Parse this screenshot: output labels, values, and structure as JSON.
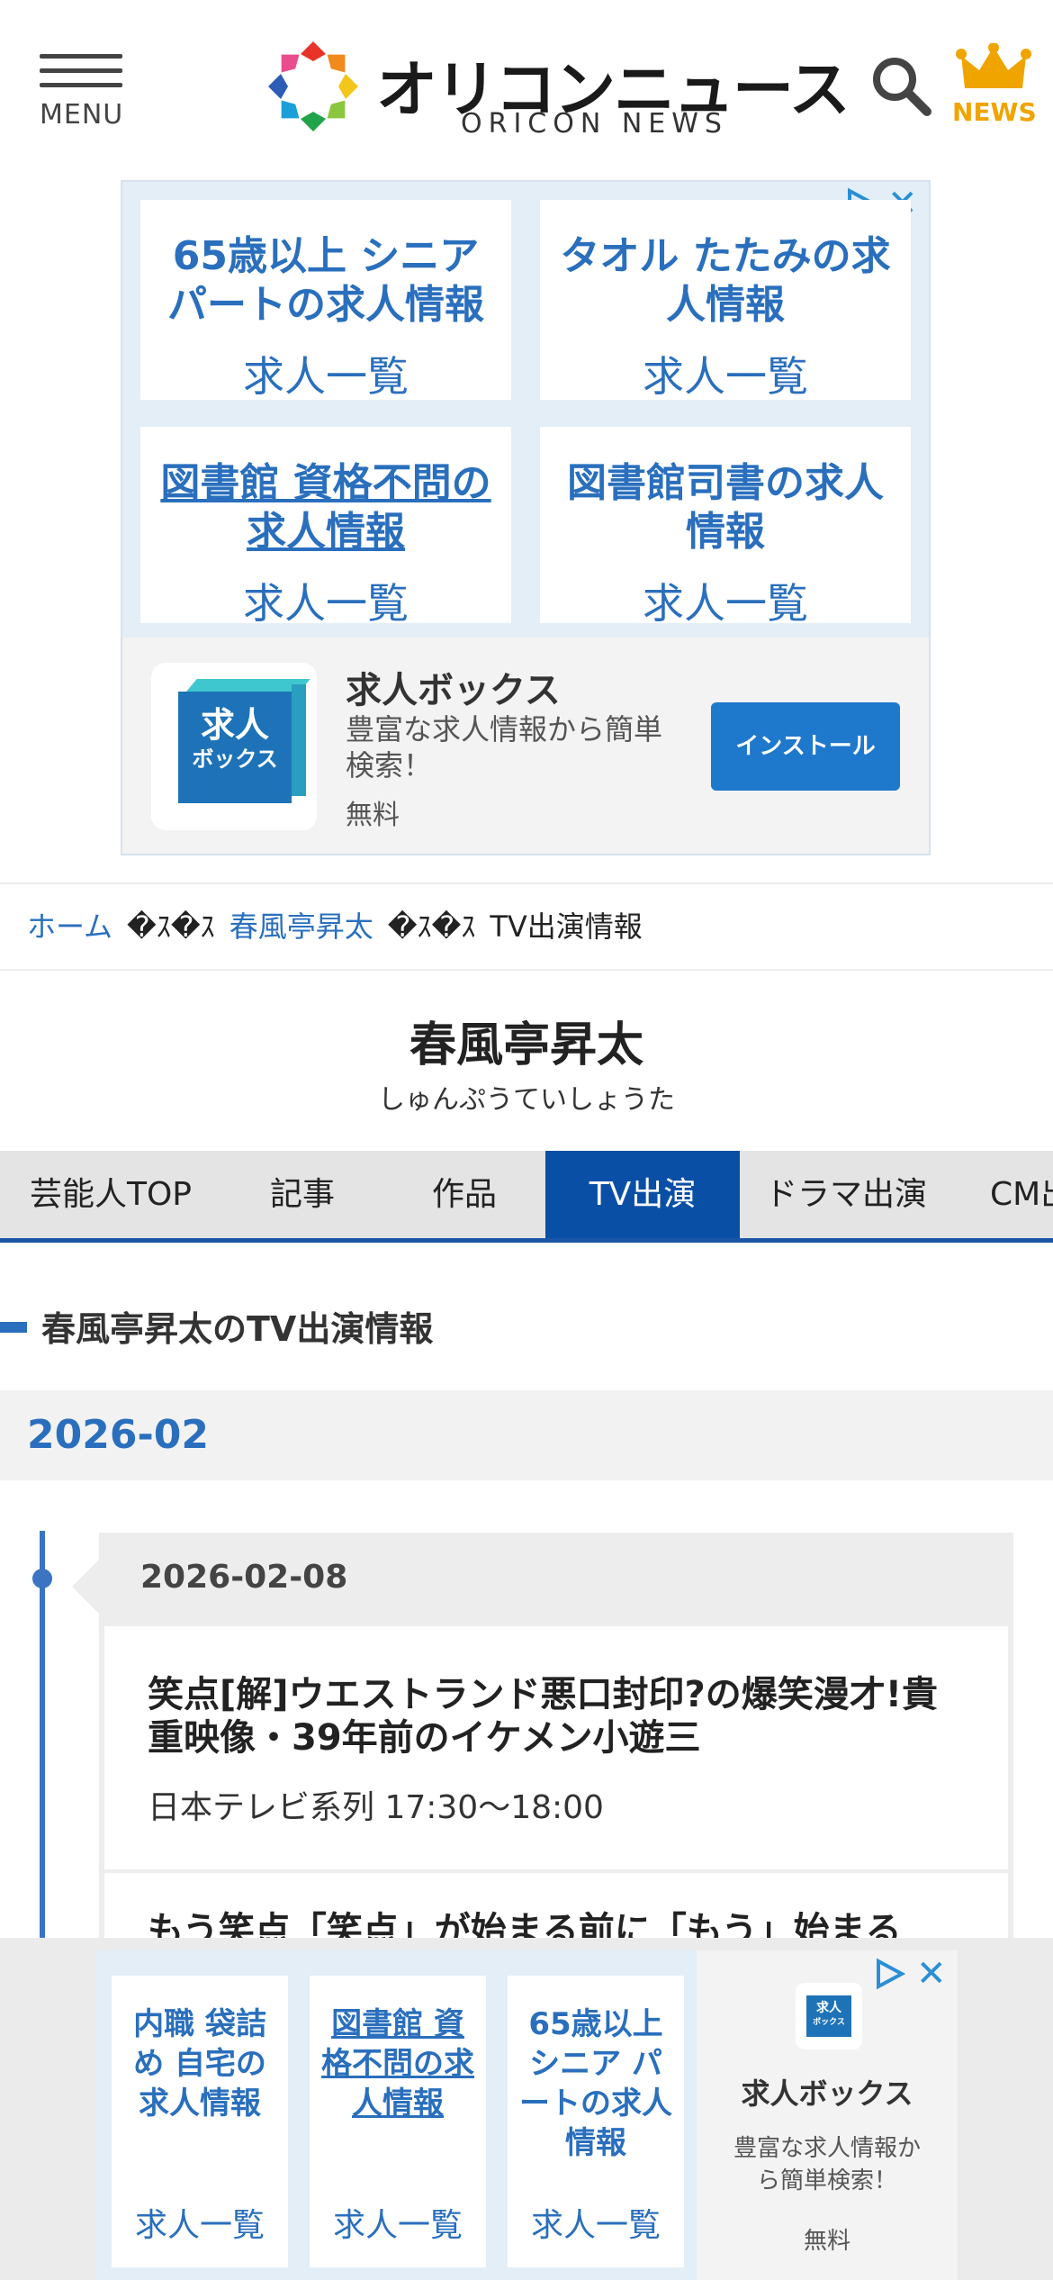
{
  "header": {
    "menu_label": "MENU",
    "logo_jp": "オリコンニュース",
    "logo_en": "ORICON NEWS",
    "news_label": "NEWS"
  },
  "top_ad": {
    "tiles": [
      {
        "title": "65歳以上 シニアパートの求人情報",
        "subtitle": "求人一覧"
      },
      {
        "title": "タオル たたみの求人情報",
        "subtitle": "求人一覧"
      },
      {
        "title": "図書館 資格不問の求人情報",
        "subtitle": "求人一覧"
      },
      {
        "title": "図書館司書の求人情報",
        "subtitle": "求人一覧"
      }
    ],
    "app": {
      "icon_line1": "求人",
      "icon_line2": "ボックス",
      "name": "求人ボックス",
      "description": "豊富な求人情報から簡単検索！",
      "price": "無料",
      "install_label": "インストール"
    },
    "close_glyph": "✕"
  },
  "breadcrumb": {
    "home": "ホーム",
    "separator": "�ｽ�ｽ",
    "person": "春風亭昇太",
    "current": "TV出演情報"
  },
  "profile": {
    "name": "春風亭昇太",
    "kana": "しゅんぷうていしょうた"
  },
  "tabs": [
    {
      "label": "芸能人TOP",
      "active": false
    },
    {
      "label": "記事",
      "active": false
    },
    {
      "label": "作品",
      "active": false
    },
    {
      "label": "TV出演",
      "active": true
    },
    {
      "label": "ドラマ出演",
      "active": false
    },
    {
      "label": "CM出演",
      "active": false
    }
  ],
  "section": {
    "heading": "春風亭昇太のTV出演情報",
    "month": "2026-02"
  },
  "timeline": {
    "date": "2026-02-08",
    "programs": [
      {
        "title": "笑点[解]ウエストランド悪口封印?の爆笑漫才!貴重映像・39年前のイケメン小遊三",
        "meta": "日本テレビ系列 17:30〜18:00"
      },
      {
        "title": "もう笑点「笑点」が始まる前に「もう」始まる"
      }
    ]
  },
  "bottom_ad": {
    "tiles": [
      {
        "title": "内職 袋詰め 自宅の求人情報",
        "subtitle": "求人一覧"
      },
      {
        "title": "図書館 資格不問の求人情報",
        "subtitle": "求人一覧"
      },
      {
        "title": "65歳以上 シニア パートの求人情報",
        "subtitle": "求人一覧"
      }
    ],
    "app": {
      "icon_line1": "求人",
      "icon_line2": "ボックス",
      "name": "求人ボックス",
      "description": "豊富な求人情報から簡単検索！",
      "price": "無料"
    },
    "close_glyph": "✕"
  },
  "colors": {
    "link_blue": "#2a6fbd",
    "tab_active": "#0a4fa6",
    "news_gold": "#f0a400",
    "ad_bg": "#e3eef7"
  }
}
